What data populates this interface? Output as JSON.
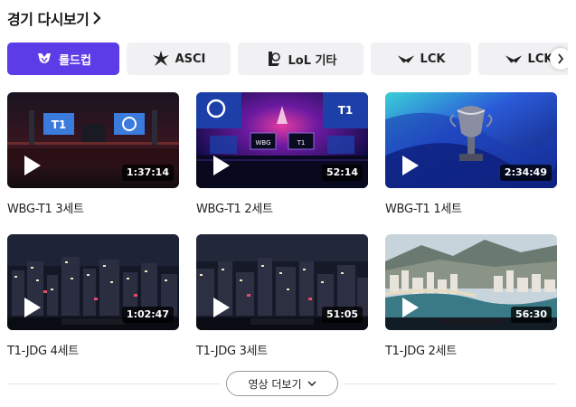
{
  "header": {
    "title": "경기 다시보기"
  },
  "chips": [
    {
      "label": "롤드컵",
      "icon": "worlds-logo-icon",
      "active": true
    },
    {
      "label": "ASCI",
      "icon": "asci-logo-icon",
      "active": false
    },
    {
      "label": "LoL 기타",
      "icon": "lol-logo-icon",
      "active": false
    },
    {
      "label": "LCK",
      "icon": "lck-logo-icon",
      "active": false
    },
    {
      "label": "LCK",
      "icon": "lck-logo-icon",
      "active": false
    }
  ],
  "videos": [
    {
      "title": "WBG-T1 3세트",
      "duration": "1:37:14",
      "scene": "stage-screens"
    },
    {
      "title": "WBG-T1 2세트",
      "duration": "52:14",
      "scene": "stage-neon"
    },
    {
      "title": "WBG-T1 1세트",
      "duration": "2:34:49",
      "scene": "trophy"
    },
    {
      "title": "T1-JDG 4세트",
      "duration": "1:02:47",
      "scene": "city-night"
    },
    {
      "title": "T1-JDG 3세트",
      "duration": "51:05",
      "scene": "city-night-2"
    },
    {
      "title": "T1-JDG 2세트",
      "duration": "56:30",
      "scene": "city-day"
    }
  ],
  "more_button": {
    "label": "영상 더보기"
  },
  "colors": {
    "accent": "#5b3ce6",
    "chip_bg": "#f1f1f4"
  }
}
